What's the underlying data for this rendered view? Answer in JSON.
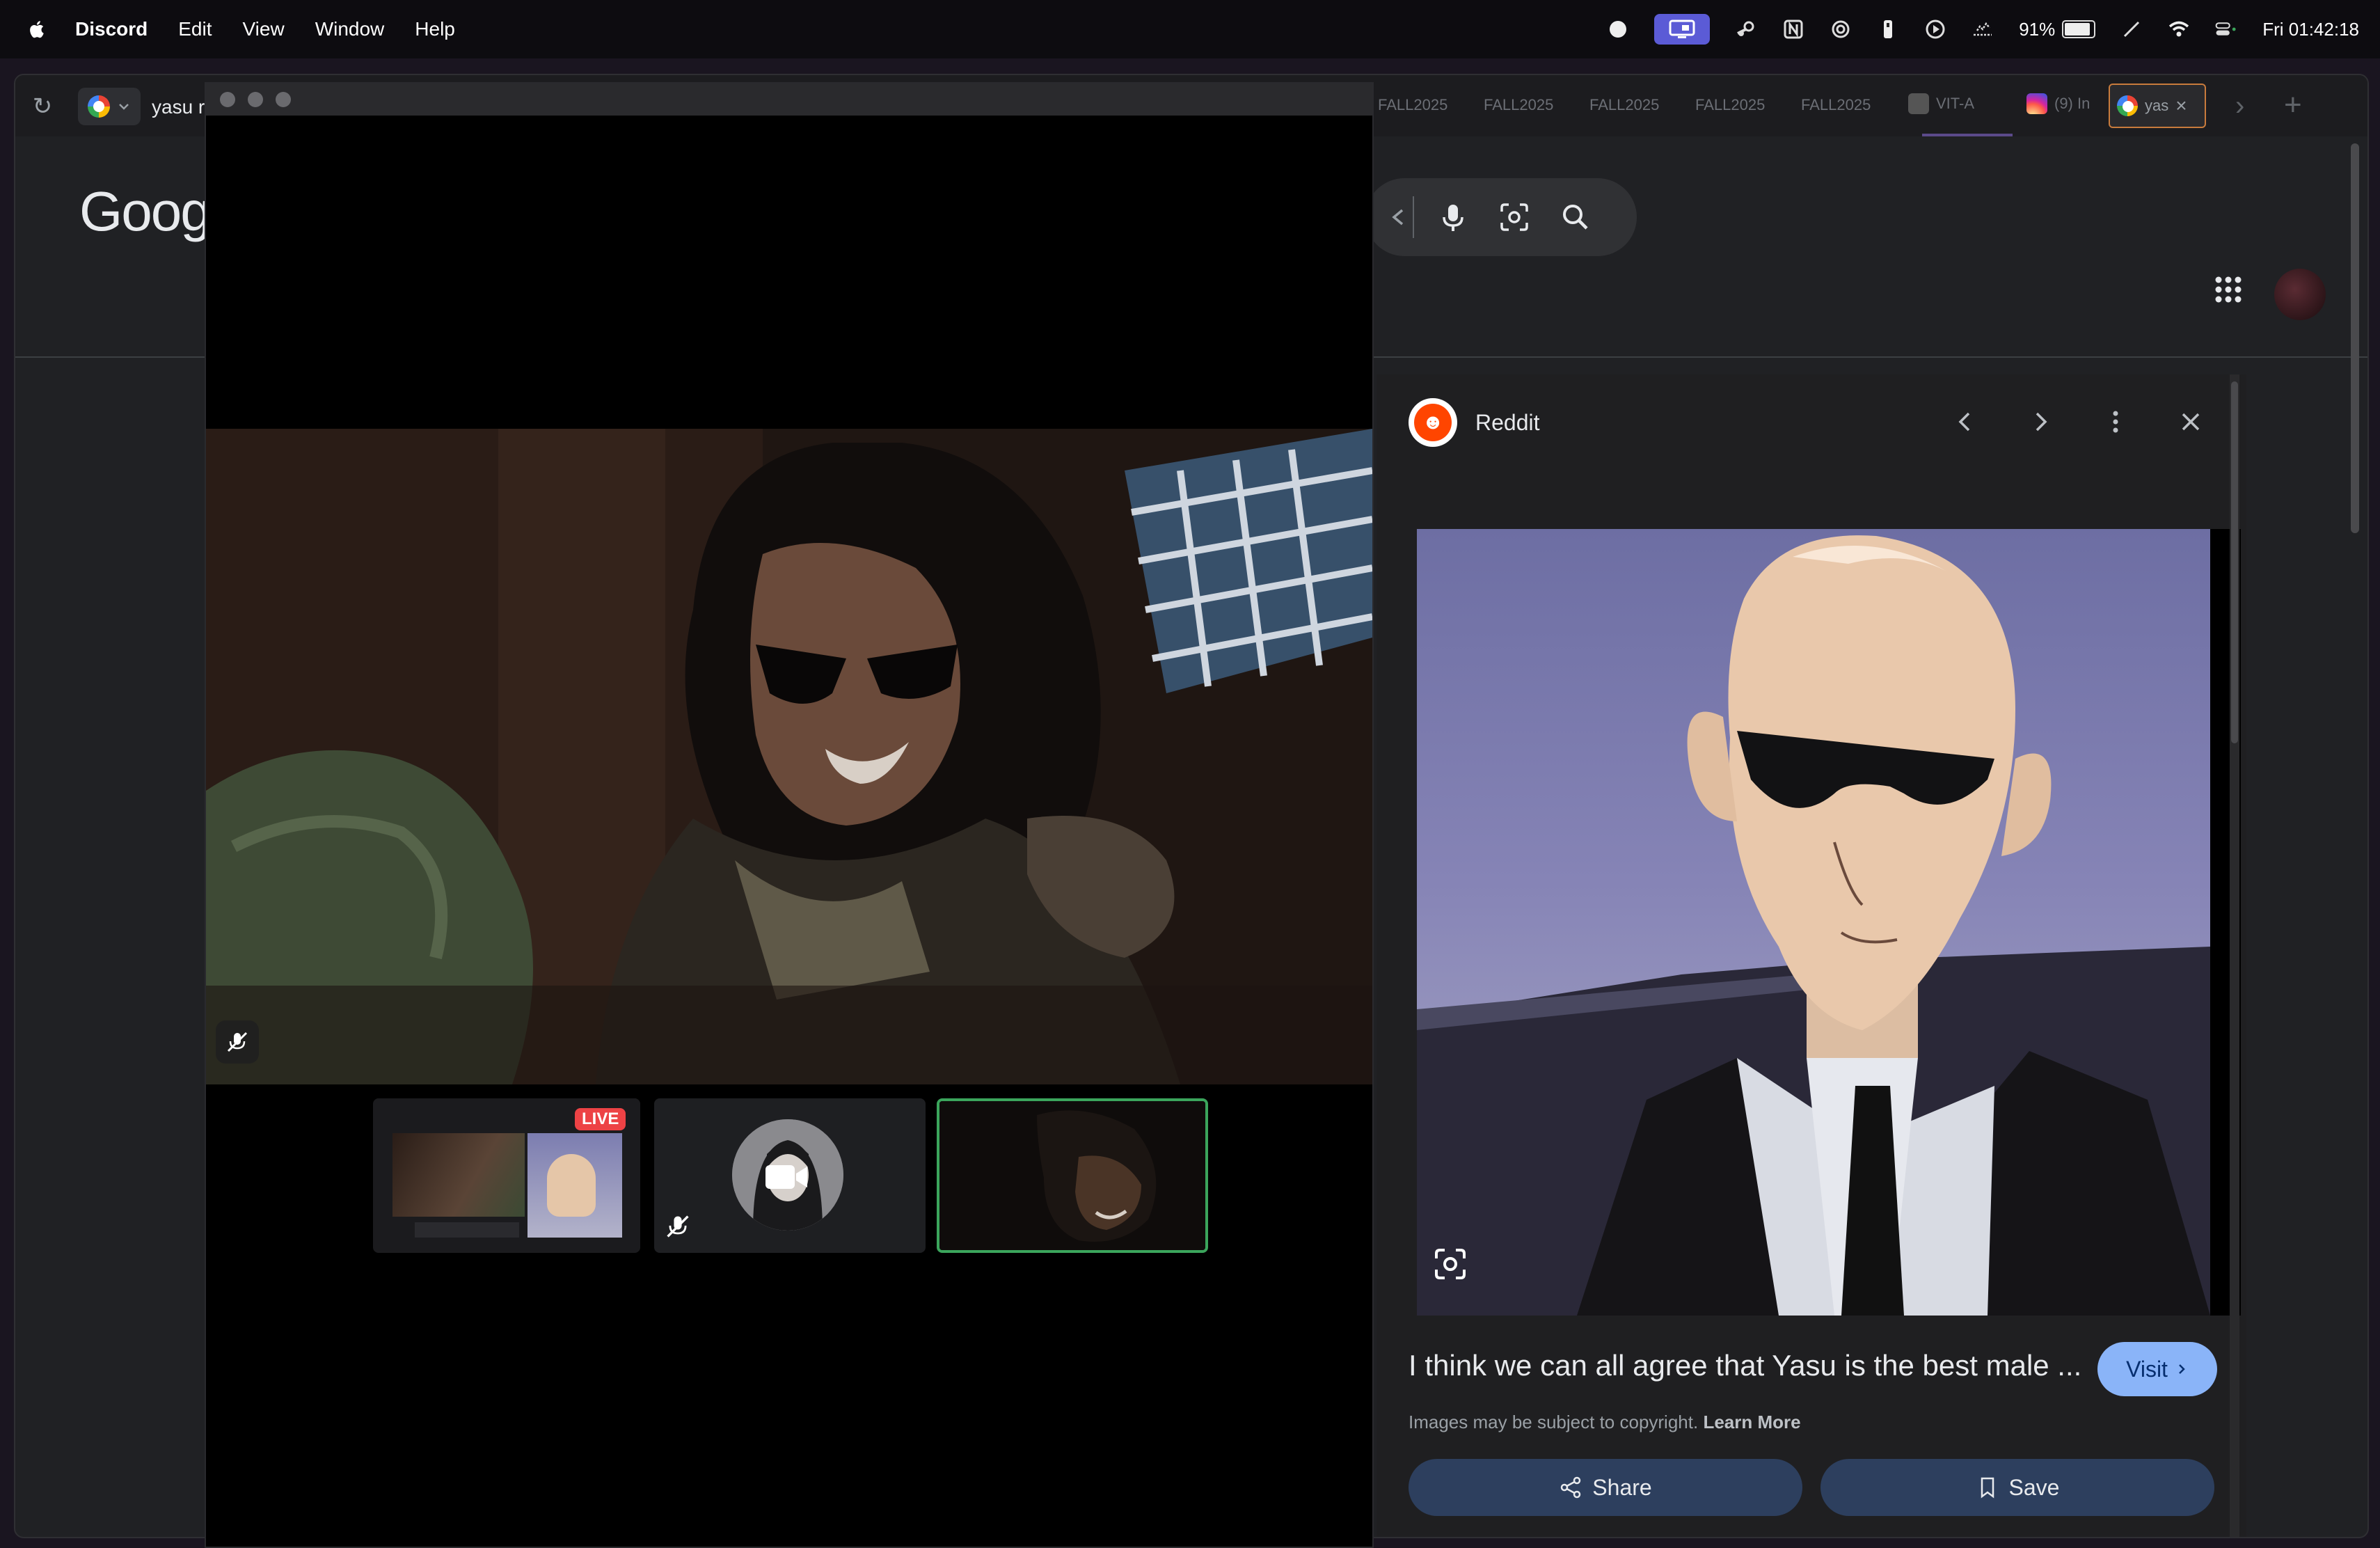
{
  "menubar": {
    "app_name": "Discord",
    "menus": [
      "Edit",
      "View",
      "Window",
      "Help"
    ],
    "battery_pct": "91%",
    "clock": "Fri 01:42:18"
  },
  "browser": {
    "query_prefix": "yasu r",
    "background_tabs": [
      "FALL2025",
      "FALL2025",
      "FALL2025",
      "FALL2025",
      "FALL2025",
      "VIT-A",
      "(9) In"
    ],
    "active_tab_label": "yas",
    "google_logo_text": "Googl"
  },
  "side_panel": {
    "source_name": "Reddit",
    "result_title": "I think we can all agree that Yasu is the best male ...",
    "visit_label": "Visit",
    "copyright_text": "Images may be subject to copyright.",
    "learn_more": "Learn More",
    "share_label": "Share",
    "save_label": "Save"
  },
  "discord": {
    "live_badge": "LIVE"
  },
  "colors": {
    "discord_blurple": "#5b5bd6",
    "speaking_green": "#3ba55c",
    "live_red": "#ed4245",
    "visit_blue": "#8ab4f8",
    "reddit_orange": "#ff4500"
  }
}
